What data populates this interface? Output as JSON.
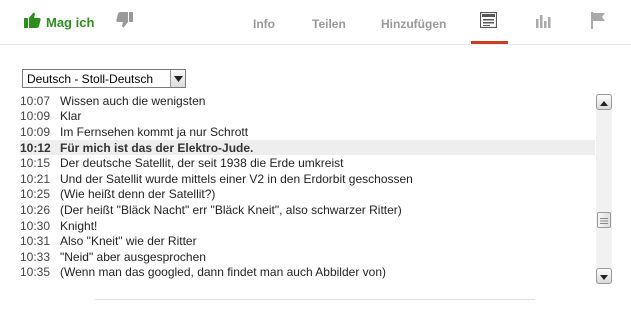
{
  "actions": {
    "like_label": "Mag ich",
    "accent_color": "#2b8e1d",
    "tabs": [
      {
        "label": "Info"
      },
      {
        "label": "Teilen"
      },
      {
        "label": "Hinzufügen"
      }
    ],
    "icon_tabs": [
      "transcript-icon",
      "statistics-icon",
      "flag-icon"
    ],
    "active_tab": "transcript",
    "active_color": "#cc3e20"
  },
  "language": {
    "selected": "Deutsch - Stoll-Deutsch"
  },
  "transcript": {
    "lines": [
      {
        "time": "10:07",
        "text": "Wissen auch die wenigsten"
      },
      {
        "time": "10:09",
        "text": "Klar"
      },
      {
        "time": "10:09",
        "text": "Im Fernsehen kommt ja nur Schrott"
      },
      {
        "time": "10:12",
        "text": "Für mich ist das der Elektro-Jude.",
        "active": true
      },
      {
        "time": "10:15",
        "text": "Der deutsche Satellit, der seit 1938 die Erde umkreist"
      },
      {
        "time": "10:21",
        "text": "Und der Satellit wurde mittels einer V2 in den Erdorbit geschossen"
      },
      {
        "time": "10:25",
        "text": "(Wie heißt denn der Satellit?)"
      },
      {
        "time": "10:26",
        "text": "(Der heißt \"Bläck Nacht\" err \"Bläck Kneit\", also schwarzer Ritter)"
      },
      {
        "time": "10:30",
        "text": "Knight!"
      },
      {
        "time": "10:31",
        "text": "Also \"Kneit\" wie der Ritter"
      },
      {
        "time": "10:33",
        "text": "\"Neid\" aber ausgesprochen"
      },
      {
        "time": "10:35",
        "text": "(Wenn man das googled, dann findet man auch Abbilder von)"
      }
    ]
  }
}
